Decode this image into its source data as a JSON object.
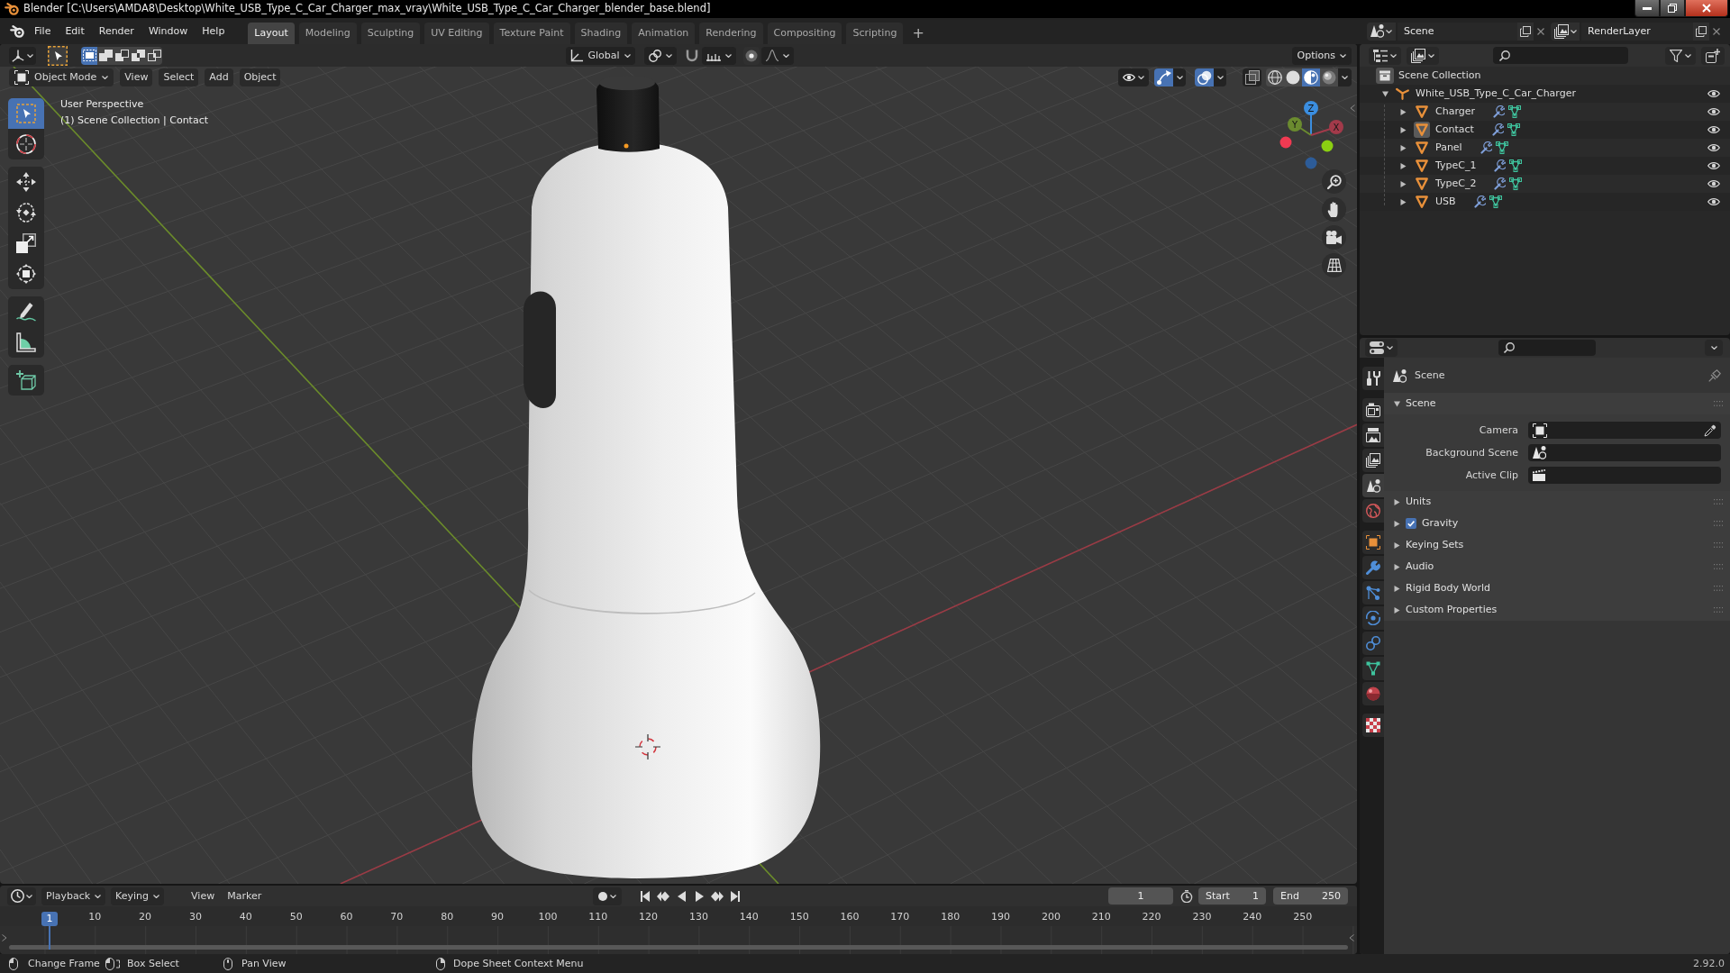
{
  "window": {
    "title": "Blender [C:\\Users\\AMDA8\\Desktop\\White_USB_Type_C_Car_Charger_max_vray\\White_USB_Type_C_Car_Charger_blender_base.blend]"
  },
  "menu": [
    "File",
    "Edit",
    "Render",
    "Window",
    "Help"
  ],
  "workspaces": [
    {
      "label": "Layout",
      "selected": true
    },
    {
      "label": "Modeling",
      "selected": false
    },
    {
      "label": "Sculpting",
      "selected": false
    },
    {
      "label": "UV Editing",
      "selected": false
    },
    {
      "label": "Texture Paint",
      "selected": false
    },
    {
      "label": "Shading",
      "selected": false
    },
    {
      "label": "Animation",
      "selected": false
    },
    {
      "label": "Rendering",
      "selected": false
    },
    {
      "label": "Compositing",
      "selected": false
    },
    {
      "label": "Scripting",
      "selected": false
    }
  ],
  "add_workspace": "+",
  "scene_selector": {
    "scene": "Scene",
    "view_layer": "RenderLayer"
  },
  "viewport": {
    "tool_header": {
      "select_modes": [
        {
          "kind": "set",
          "selected": true
        },
        {
          "kind": "extend",
          "selected": false
        },
        {
          "kind": "subtract",
          "selected": false
        },
        {
          "kind": "invert",
          "selected": false
        },
        {
          "kind": "intersect",
          "selected": false
        }
      ],
      "orientation": "Global",
      "options": "Options"
    },
    "header": {
      "mode": "Object Mode",
      "menus": [
        "View",
        "Select",
        "Add",
        "Object"
      ],
      "toggles": [
        {
          "kind": "gizmos",
          "on": true
        },
        {
          "kind": "overlays",
          "on": true
        },
        {
          "kind": "xray",
          "on": false
        }
      ],
      "shading": [
        {
          "kind": "wireframe",
          "selected": false
        },
        {
          "kind": "solid",
          "selected": false
        },
        {
          "kind": "material",
          "selected": true
        },
        {
          "kind": "rendered",
          "selected": false
        }
      ]
    },
    "tools": [
      [
        {
          "kind": "select",
          "selected": true
        },
        {
          "kind": "cursor",
          "selected": false
        }
      ],
      [
        {
          "kind": "move",
          "selected": false
        },
        {
          "kind": "rotate",
          "selected": false
        },
        {
          "kind": "scale",
          "selected": false
        },
        {
          "kind": "transform",
          "selected": false
        }
      ],
      [
        {
          "kind": "annotate",
          "selected": false
        },
        {
          "kind": "measure",
          "selected": false
        }
      ],
      [
        {
          "kind": "add_cube",
          "selected": false
        }
      ]
    ],
    "info": [
      "User Perspective",
      "(1) Scene Collection | Contact"
    ],
    "gizmo": [
      {
        "label": "X",
        "color": "#a23a4a"
      },
      {
        "label": "Y",
        "color": "#6b8b2f"
      },
      {
        "label": "Z",
        "color": "#3b8ee0"
      }
    ]
  },
  "outliner": {
    "root": "Scene Collection",
    "collections": [
      {
        "label": "White_USB_Type_C_Car_Charger",
        "expanded": true,
        "children": [
          {
            "label": "Charger",
            "expanded": false,
            "selected": false
          },
          {
            "label": "Contact",
            "expanded": false,
            "selected": true
          },
          {
            "label": "Panel",
            "expanded": false,
            "selected": false
          },
          {
            "label": "TypeC_1",
            "expanded": false,
            "selected": false
          },
          {
            "label": "TypeC_2",
            "expanded": false,
            "selected": false
          },
          {
            "label": "USB",
            "expanded": false,
            "selected": false
          }
        ]
      }
    ]
  },
  "properties": {
    "tabs": [
      {
        "kind": "tool",
        "selected": false
      },
      {
        "kind": "render",
        "selected": false
      },
      {
        "kind": "output",
        "selected": false
      },
      {
        "kind": "view_layer",
        "selected": false
      },
      {
        "kind": "scene",
        "selected": true
      },
      {
        "kind": "world",
        "selected": false
      },
      {
        "kind": "object",
        "selected": false
      },
      {
        "kind": "modifiers",
        "selected": false
      },
      {
        "kind": "particles",
        "selected": false
      },
      {
        "kind": "physics",
        "selected": false
      },
      {
        "kind": "constraints",
        "selected": false
      },
      {
        "kind": "data",
        "selected": false
      },
      {
        "kind": "material",
        "selected": false
      },
      {
        "kind": "texture",
        "selected": false
      }
    ],
    "context": "Scene",
    "panels": [
      {
        "label": "Scene",
        "expanded": true,
        "fields": [
          {
            "label": "Camera",
            "kind": "camera"
          },
          {
            "label": "Background Scene",
            "kind": "scene"
          },
          {
            "label": "Active Clip",
            "kind": "clip"
          }
        ]
      },
      {
        "label": "Units",
        "expanded": false
      },
      {
        "label": "Gravity",
        "expanded": false,
        "checked": true
      },
      {
        "label": "Keying Sets",
        "expanded": false
      },
      {
        "label": "Audio",
        "expanded": false
      },
      {
        "label": "Rigid Body World",
        "expanded": false
      },
      {
        "label": "Custom Properties",
        "expanded": false
      }
    ]
  },
  "timeline": {
    "menus": [
      {
        "label": "Playback",
        "kind": "dropdown"
      },
      {
        "label": "Keying",
        "kind": "dropdown"
      },
      {
        "label": "View",
        "kind": "menu"
      },
      {
        "label": "Marker",
        "kind": "menu"
      }
    ],
    "current_frame": "1",
    "start": {
      "label": "Start",
      "value": "1"
    },
    "end": {
      "label": "End",
      "value": "250"
    },
    "playhead": "1",
    "ruler": [
      "10",
      "20",
      "30",
      "40",
      "50",
      "60",
      "70",
      "80",
      "90",
      "100",
      "110",
      "120",
      "130",
      "140",
      "150",
      "160",
      "170",
      "180",
      "190",
      "200",
      "210",
      "220",
      "230",
      "240",
      "250"
    ]
  },
  "status_bar": {
    "hints": [
      {
        "kind": "left",
        "label": "Change Frame"
      },
      {
        "kind": "drag",
        "label": "Box Select"
      },
      {
        "kind": "middle",
        "label": "Pan View"
      },
      {
        "kind": "right",
        "label": "Dope Sheet Context Menu"
      }
    ],
    "version": "2.92.0"
  }
}
